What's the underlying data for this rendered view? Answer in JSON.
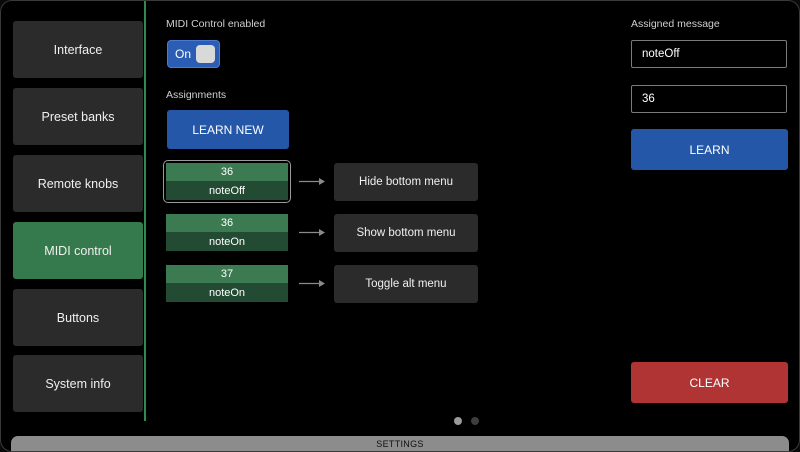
{
  "sidebar": {
    "items": [
      {
        "label": "Interface"
      },
      {
        "label": "Preset banks"
      },
      {
        "label": "Remote knobs"
      },
      {
        "label": "MIDI control"
      },
      {
        "label": "Buttons"
      },
      {
        "label": "System info"
      }
    ],
    "active_index": 3
  },
  "midi": {
    "enabled_label": "MIDI Control enabled",
    "toggle_label": "On",
    "toggle_on": true
  },
  "assignments": {
    "heading": "Assignments",
    "learn_new_label": "LEARN NEW",
    "items": [
      {
        "number": "36",
        "message": "noteOff",
        "action": "Hide bottom menu",
        "selected": true
      },
      {
        "number": "36",
        "message": "noteOn",
        "action": "Show bottom menu",
        "selected": false
      },
      {
        "number": "37",
        "message": "noteOn",
        "action": "Toggle alt menu",
        "selected": false
      }
    ]
  },
  "assigned": {
    "heading": "Assigned message",
    "message_value": "noteOff",
    "number_value": "36",
    "learn_label": "LEARN",
    "clear_label": "CLEAR"
  },
  "pagination": {
    "current": 1,
    "total": 2
  },
  "bottom_bar": {
    "label": "SETTINGS"
  },
  "colors": {
    "accent_green": "#357a4c",
    "accent_blue": "#2557a8",
    "danger_red": "#b03434",
    "background": "#000000"
  }
}
